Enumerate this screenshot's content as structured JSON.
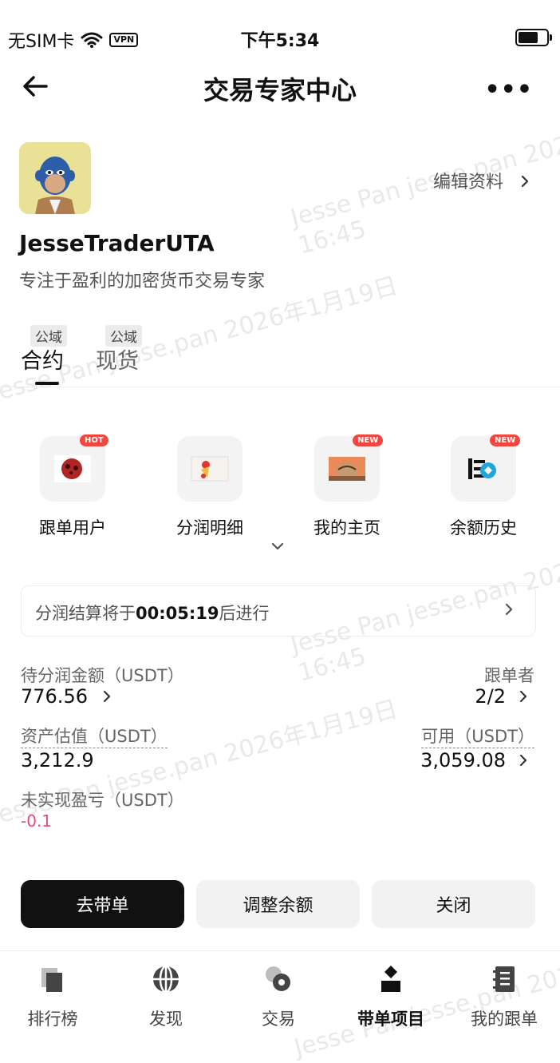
{
  "status_bar": {
    "carrier": "无SIM卡",
    "vpn": "VPN",
    "time": "下午5:34"
  },
  "header": {
    "title": "交易专家中心",
    "more": "•••"
  },
  "watermark": {
    "line1": "Jesse Pan jesse.pan 2026年1月19日",
    "line2": "16:45"
  },
  "profile": {
    "edit_label": "编辑资料",
    "username": "JesseTraderUTA",
    "bio": "专注于盈利的加密货币交易专家"
  },
  "tabs": [
    {
      "badge": "公域",
      "label": "合约",
      "active": true
    },
    {
      "badge": "公域",
      "label": "现货",
      "active": false
    }
  ],
  "quick_actions": [
    {
      "label": "跟单用户",
      "badge": "HOT",
      "icon": "follower-users-icon"
    },
    {
      "label": "分润明细",
      "badge": "",
      "icon": "profit-detail-icon"
    },
    {
      "label": "我的主页",
      "badge": "NEW",
      "icon": "my-homepage-icon"
    },
    {
      "label": "余额历史",
      "badge": "NEW",
      "icon": "balance-history-icon"
    }
  ],
  "countdown": {
    "prefix": "分润结算将于",
    "time": "00:05:19",
    "suffix": "后进行"
  },
  "stats": {
    "pending_profit": {
      "label": "待分润金额（USDT）",
      "value": "776.56"
    },
    "followers": {
      "label": "跟单者",
      "value": "2/2"
    },
    "asset_value": {
      "label": "资产估值（USDT）",
      "value": "3,212.9"
    },
    "available": {
      "label": "可用（USDT）",
      "value": "3,059.08"
    },
    "unrealized_pnl": {
      "label": "未实现盈亏（USDT）",
      "value": "-0.1"
    }
  },
  "buttons": {
    "start": "去带单",
    "adjust": "调整余额",
    "close": "关闭"
  },
  "bottom_nav": [
    {
      "label": "排行榜",
      "icon": "leaderboard-icon",
      "active": false
    },
    {
      "label": "发现",
      "icon": "discover-icon",
      "active": false
    },
    {
      "label": "交易",
      "icon": "trade-icon",
      "active": false
    },
    {
      "label": "带单项目",
      "icon": "lead-project-icon",
      "active": true
    },
    {
      "label": "我的跟单",
      "icon": "my-copy-icon",
      "active": false
    }
  ],
  "colors": {
    "negative": "#e34b84",
    "badge_red": "#f2473f",
    "primary": "#111111"
  }
}
